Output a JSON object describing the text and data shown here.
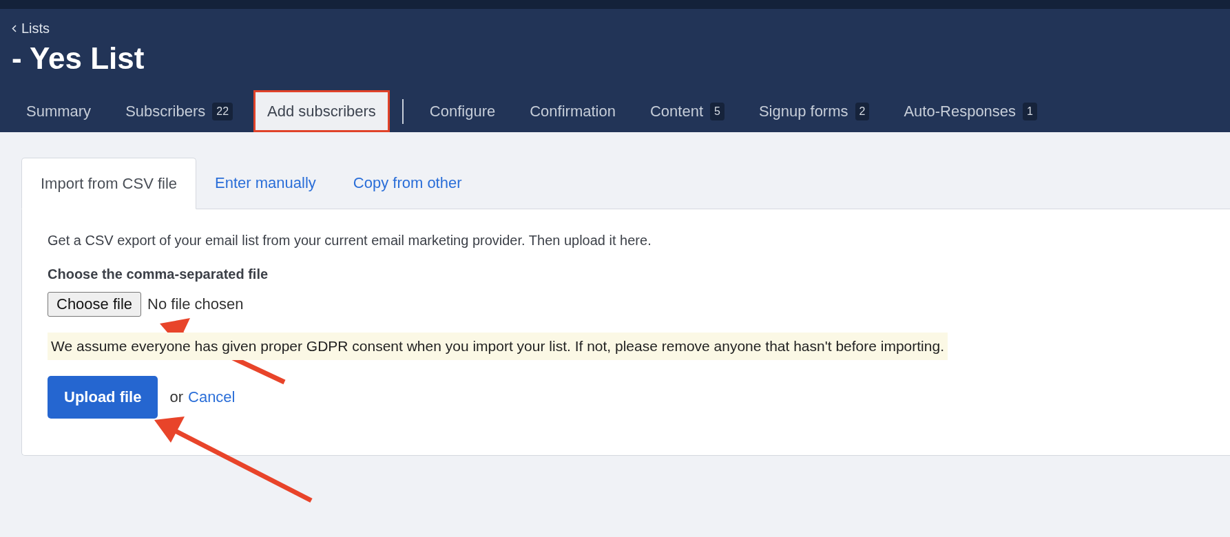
{
  "header": {
    "back_link": "Lists",
    "title": "- Yes List"
  },
  "nav_tabs": [
    {
      "label": "Summary",
      "selected": false,
      "highlighted": false
    },
    {
      "label": "Subscribers",
      "badge": "22",
      "selected": false,
      "highlighted": false
    },
    {
      "label": "Add subscribers",
      "selected": true,
      "highlighted": true
    },
    {
      "label": "Configure",
      "selected": false,
      "highlighted": false
    },
    {
      "label": "Confirmation",
      "selected": false,
      "highlighted": false
    },
    {
      "label": "Content",
      "badge": "5",
      "selected": false,
      "highlighted": false
    },
    {
      "label": "Signup forms",
      "badge": "2",
      "selected": false,
      "highlighted": false
    },
    {
      "label": "Auto-Responses",
      "badge": "1",
      "selected": false,
      "highlighted": false
    }
  ],
  "import_tabs": [
    {
      "label": "Import from CSV file",
      "selected": true
    },
    {
      "label": "Enter manually",
      "selected": false
    },
    {
      "label": "Copy from other",
      "selected": false
    }
  ],
  "import_form": {
    "description": "Get a CSV export of your email list from your current email marketing provider. Then upload it here.",
    "file_label": "Choose the comma-separated file",
    "file_button": "Choose file",
    "file_status": "No file chosen",
    "notice": "We assume everyone has given proper GDPR consent when you import your list. If not, please remove anyone that hasn't before importing.",
    "upload_button": "Upload file",
    "or_text": "or",
    "cancel_link": "Cancel"
  }
}
